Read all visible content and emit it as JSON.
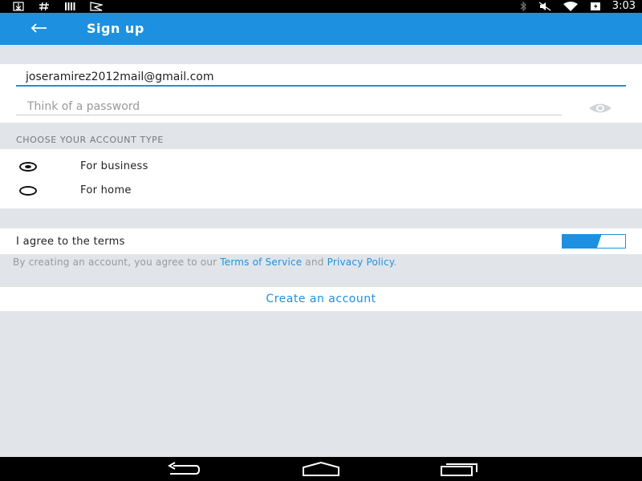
{
  "status_bar": {
    "time": "3:03",
    "left_icons": [
      "download-icon",
      "hash-icon",
      "bars-icon",
      "flag-icon"
    ],
    "right_icons": [
      "bluetooth-icon",
      "mute-icon",
      "wifi-icon",
      "battery-icon"
    ]
  },
  "app_bar": {
    "title": "Sign up",
    "back_icon": "arrow-left-icon",
    "color": "#1e90e0"
  },
  "form": {
    "email_value": "joseramirez2012mail@gmail.com",
    "password_placeholder": "Think of a password",
    "password_icon": "eye-icon"
  },
  "account_type": {
    "heading": "CHOOSE YOUR ACCOUNT TYPE",
    "options": [
      {
        "label": "For business",
        "selected": true
      },
      {
        "label": "For home",
        "selected": false
      }
    ]
  },
  "terms": {
    "label": "I agree to the terms",
    "toggle_on": true,
    "legal_prefix": "By creating an account, you agree to our ",
    "terms_link": "Terms of Service",
    "legal_and": " and ",
    "privacy_link": "Privacy Policy",
    "legal_suffix": "."
  },
  "actions": {
    "create_label": "Create an account"
  },
  "nav": {
    "icons": [
      "back-nav-icon",
      "home-nav-icon",
      "recents-nav-icon"
    ]
  }
}
